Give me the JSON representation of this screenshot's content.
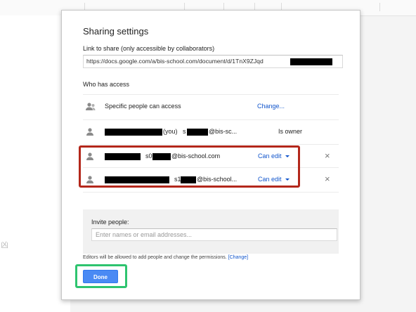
{
  "dialog": {
    "title": "Sharing settings",
    "link_label": "Link to share (only accessible by collaborators)",
    "link_value": "https://docs.google.com/a/bis-school.com/document/d/1TnX9ZJqd",
    "access_label": "Who has access"
  },
  "access_rows": [
    {
      "text": "Specific people can access",
      "action": "Change..."
    },
    {
      "you": "(you)",
      "email_prefix": "s",
      "email_suffix": "@bis-sc...",
      "role": "Is owner"
    },
    {
      "email_prefix": "s0",
      "email_suffix": "@bis-school.com",
      "role": "Can edit",
      "remove": "×"
    },
    {
      "email_prefix": "s1",
      "email_suffix": "@bis-school...",
      "role": "Can edit",
      "remove": "×"
    }
  ],
  "invite": {
    "label": "Invite people:",
    "placeholder": "Enter names or email addresses..."
  },
  "note": {
    "text": "Editors will be allowed to add people and change the permissions.",
    "link": "[Change]"
  },
  "done_label": "Done",
  "background": {
    "glyph": "凶"
  },
  "colors": {
    "link": "#1155cc",
    "primary": "#4a8af4",
    "highlight_red": "#b3271b",
    "highlight_green": "#2ec46f"
  },
  "icons": {
    "person": "person-icon",
    "caret": "caret-down-icon",
    "remove": "close-icon"
  }
}
